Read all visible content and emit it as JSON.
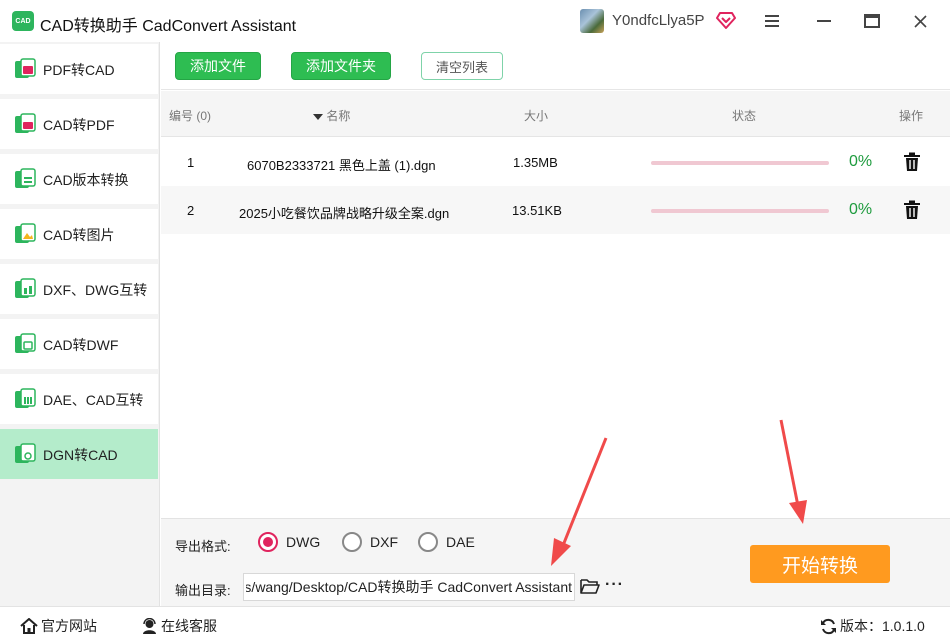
{
  "app": {
    "logo_text": "CAD",
    "title": "CAD转换助手 CadConvert Assistant",
    "username": "Y0ndfcLlya5P"
  },
  "sidebar": {
    "items": [
      {
        "label": "PDF转CAD",
        "active": false
      },
      {
        "label": "CAD转PDF",
        "active": false
      },
      {
        "label": "CAD版本转换",
        "active": false
      },
      {
        "label": "CAD转图片",
        "active": false
      },
      {
        "label": "DXF、DWG互转",
        "active": false
      },
      {
        "label": "CAD转DWF",
        "active": false
      },
      {
        "label": "DAE、CAD互转",
        "active": false
      },
      {
        "label": "DGN转CAD",
        "active": true
      }
    ]
  },
  "toolbar": {
    "add_file": "添加文件",
    "add_folder": "添加文件夹",
    "clear_list": "清空列表"
  },
  "table": {
    "headers": {
      "index": "编号 (0)",
      "name": "名称",
      "size": "大小",
      "status": "状态",
      "action": "操作"
    },
    "rows": [
      {
        "index": "1",
        "name": "6070B2333721 黑色上盖 (1).dgn",
        "size": "1.35MB",
        "progress": 0,
        "percent": "0%"
      },
      {
        "index": "2",
        "name": "2025小吃餐饮品牌战略升级全案.dgn",
        "size": "13.51KB",
        "progress": 0,
        "percent": "0%"
      }
    ]
  },
  "output": {
    "format_label": "导出格式:",
    "formats": [
      {
        "label": "DWG",
        "checked": true
      },
      {
        "label": "DXF",
        "checked": false
      },
      {
        "label": "DAE",
        "checked": false
      }
    ],
    "dir_label": "输出目录:",
    "dir_value": "C:/Users/wang/Desktop/CAD转换助手 CadConvert Assistant",
    "more": "···",
    "start_button": "开始转换"
  },
  "statusbar": {
    "website": "官方网站",
    "support": "在线客服",
    "version": "版本：1.0.1.0"
  },
  "colors": {
    "accent_green": "#2ebd52",
    "active_item": "#b4eccb",
    "start_orange": "#ff9a1f",
    "radio_checked": "#e0245e",
    "percent_green": "#1e9b3e"
  }
}
